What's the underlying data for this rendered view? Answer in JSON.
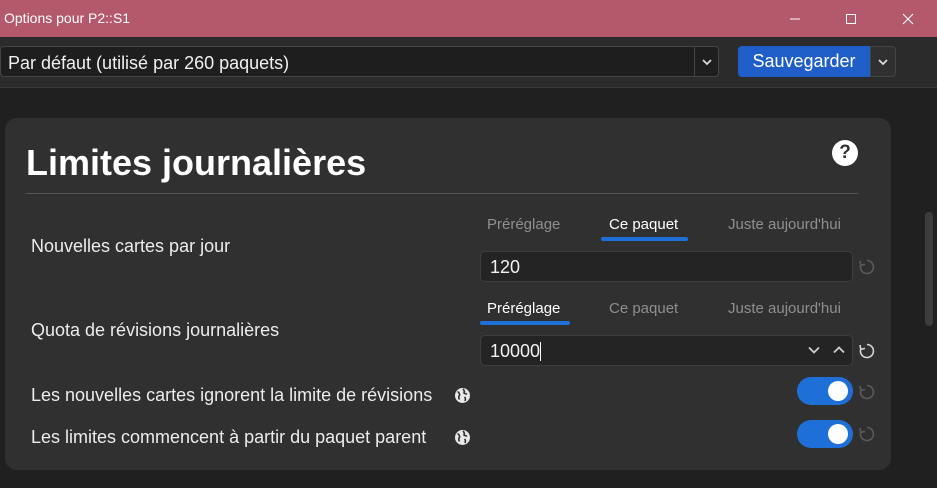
{
  "window": {
    "title": "Options pour P2::S1"
  },
  "toolbar": {
    "preset_value": "Par défaut (utilisé par 260 paquets)",
    "save_label": "Sauvegarder"
  },
  "section": {
    "title": "Limites journalières",
    "help_glyph": "?"
  },
  "new_cards": {
    "label": "Nouvelles cartes par jour",
    "tabs": [
      "Préréglage",
      "Ce paquet",
      "Juste aujourd'hui"
    ],
    "active_tab": "Ce paquet",
    "value": "120"
  },
  "reviews": {
    "label": "Quota de révisions journalières",
    "tabs": [
      "Préréglage",
      "Ce paquet",
      "Juste aujourd'hui"
    ],
    "active_tab": "Préréglage",
    "value": "10000"
  },
  "toggles": [
    {
      "label": "Les nouvelles cartes ignorent la limite de révisions",
      "on": true
    },
    {
      "label": "Les limites commencent à partir du paquet parent",
      "on": true
    }
  ],
  "colors": {
    "titlebar": "#b3596b",
    "accent": "#1f6fd8",
    "save_button": "#1f5ec8",
    "card": "#303030",
    "background": "#202020"
  },
  "icons": {
    "minimize": "minimize-icon",
    "maximize": "maximize-icon",
    "close": "close-icon",
    "dropdown": "chevron-down-icon",
    "help": "question-circle-icon",
    "revert": "revert-icon",
    "info": "globe-icon"
  }
}
